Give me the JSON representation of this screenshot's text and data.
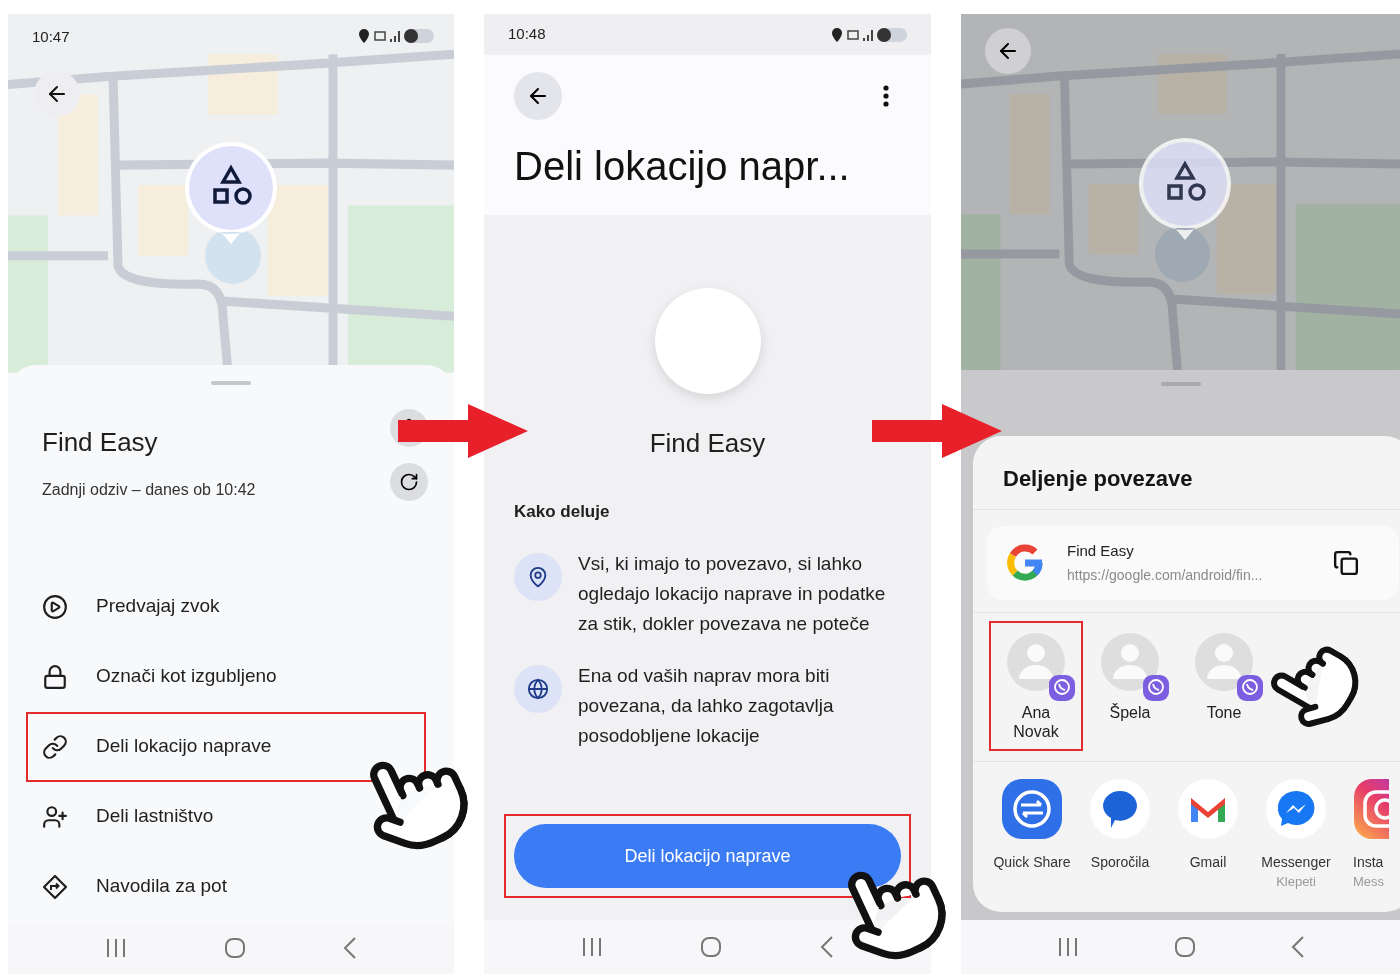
{
  "screen_1": {
    "status_time": "10:47",
    "device_name": "Find Easy",
    "last_seen": "Zadnji odziv – danes ob 10:42",
    "actions": [
      {
        "kind": "play",
        "label": "Predvajaj zvok",
        "selected": false
      },
      {
        "kind": "lock",
        "label": "Označi kot izgubljeno",
        "selected": false
      },
      {
        "kind": "link",
        "label": "Deli lokacijo naprave",
        "selected": true
      },
      {
        "kind": "person",
        "label": "Deli lastništvo",
        "selected": false
      },
      {
        "kind": "directions",
        "label": "Navodila za pot",
        "selected": false
      }
    ]
  },
  "screen_2": {
    "status_time": "10:48",
    "title": "Deli lokacijo napr...",
    "device_name": "Find Easy",
    "section_title": "Kako deluje",
    "info": [
      {
        "kind": "pin",
        "text": "Vsi, ki imajo to povezavo, si lahko ogledajo lokacijo naprave in podatke za stik, dokler povezava ne poteče"
      },
      {
        "kind": "globe",
        "text": "Ena od vaših naprav mora biti povezana, da lahko zagotavlja posodobljene lokacije"
      }
    ],
    "button": {
      "label": "Deli lokacijo naprave",
      "selected": true
    }
  },
  "screen_3": {
    "sheet_title": "Deljenje povezave",
    "link": {
      "title": "Find Easy",
      "url": "https://google.com/android/fin..."
    },
    "contacts": [
      {
        "name": "Ana Novak",
        "selected": true
      },
      {
        "name": "Špela",
        "selected": false
      },
      {
        "name": "Tone",
        "selected": false
      }
    ],
    "apps": [
      {
        "kind": "quickshare",
        "name": "Quick Share"
      },
      {
        "kind": "messages",
        "name": "Sporočila"
      },
      {
        "kind": "gmail",
        "name": "Gmail"
      },
      {
        "kind": "messenger",
        "name": "Messenger",
        "subtitle": "Klepeti"
      },
      {
        "kind": "instagram",
        "name": "Insta",
        "subtitle": "Mess"
      }
    ]
  }
}
